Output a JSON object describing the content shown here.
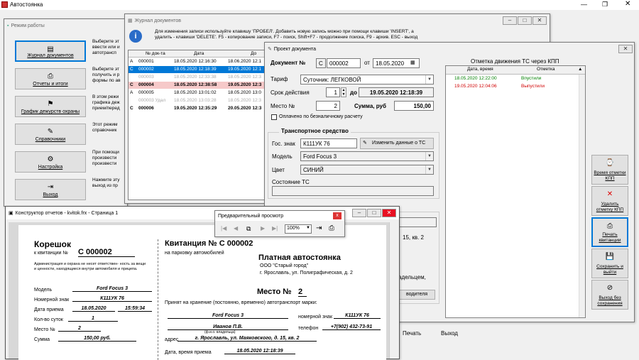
{
  "app": {
    "title": "Автостоянка"
  },
  "mode_window": {
    "title": "Режим работы",
    "buttons": [
      {
        "label": "Журнал документов",
        "icon": "journal-icon",
        "desc": "Выберите эт ввести или и автотрансп"
      },
      {
        "label": "Отчеты и итоги",
        "icon": "printer-icon",
        "desc": "Выберите эт получить и р формы по ав"
      },
      {
        "label": "График дежурств охраны",
        "icon": "guard-icon",
        "desc": "В этом режи графика деж прием/перед"
      },
      {
        "label": "Справочники",
        "icon": "book-icon",
        "desc": "Этот режим справочник"
      },
      {
        "label": "Настройка",
        "icon": "settings-icon",
        "desc": "При помощи произвести произвести"
      },
      {
        "label": "Выход",
        "icon": "exit-icon",
        "desc": "Нажмите эту выход из пр"
      }
    ]
  },
  "journal": {
    "title": "Журнал документов",
    "hint": "Для изменения записи используйте клавишу 'ПРОБЕЛ'. Добавить новую запись можно при помощи клавиши 'INSERT', а удалить - клавиши 'DELETE'. F5 - копирование записи, F7 - поиск, Shift+F7 - продолжение поиска, F9 - архив. ESC - выход",
    "columns": [
      "№ док-та",
      "Дата",
      "До"
    ],
    "rows": [
      {
        "mark": "A",
        "num": "000001",
        "date": "18.05.2020 12:16:30",
        "to": "18.06.2020 12:1"
      },
      {
        "mark": "C",
        "num": "000002",
        "date": "18.05.2020 12:18:39",
        "to": "19.05.2020 12:1"
      },
      {
        "mark": "",
        "num": "000003",
        "date": "18.05.2020 12:33:38",
        "to": "18.05.2020 12:3"
      },
      {
        "mark": "C",
        "num": "000004",
        "date": "18.05.2020 12:38:58",
        "to": "19.05.2020 12:3"
      },
      {
        "mark": "A",
        "num": "000005",
        "date": "18.05.2020 13:01:02",
        "to": "18.05.2020 13:0"
      },
      {
        "mark": "",
        "num": "000003 Удал",
        "date": "18.05.2020 13:03:28",
        "to": "18.05.2020 12:3"
      },
      {
        "mark": "C",
        "num": "000006",
        "date": "19.05.2020 12:35:29",
        "to": "20.05.2020 12:3"
      }
    ]
  },
  "project": {
    "title": "Проект документа",
    "doc_label": "Документ №",
    "doc_prefix": "C",
    "doc_num": "000002",
    "date_label": "от",
    "date": "18.05.2020",
    "tariff_label": "Тариф",
    "tariff": "Суточник: ЛЕГКОВОЙ",
    "term_label": "Срок действия",
    "term": "1",
    "until_label": "до",
    "until": "19.05.2020 12:18:39",
    "place_label": "Место №",
    "place": "2",
    "sum_label": "Сумма, руб",
    "sum": "150,00",
    "paid_label": "Оплачено по безналичному расчету",
    "vehicle_group": "Транспортное средство",
    "plate_label": "Гос. знак",
    "plate": "К111УК 76",
    "edit_vehicle": "Изменить данные о ТС",
    "model_label": "Модель",
    "model": "Ford Focus 3",
    "color_label": "Цвет",
    "color": "СИНИЙ",
    "state_label": "Состояние ТС",
    "state": "",
    "behind_addr": "15, кв. 2",
    "behind_owner": "адельцем,",
    "behind_driver": "водителя",
    "kpp_title": "Отметка движения ТС через КПП",
    "kpp_cols": [
      "Дата, время",
      "Отметка"
    ],
    "kpp_rows": [
      {
        "dt": "18.05.2020 12:22:00",
        "mark": "Впустили",
        "color": "#008000"
      },
      {
        "dt": "19.05.2020 12:04:06",
        "mark": "Выпустили",
        "color": "#d00000"
      }
    ],
    "side_buttons": [
      "Время отметки КПП",
      "Удалить отметку КПП",
      "Печать квитанции",
      "Сохранить и выйти",
      "Выход без сохранения"
    ],
    "bottom_print": "Печать",
    "bottom_exit": "Выход"
  },
  "preview": {
    "title": "Предварительный просмотр",
    "zoom": "100%"
  },
  "designer": {
    "title": "Конструктор отчетов - kvitok.frx - Страница 1"
  },
  "receipt": {
    "stub_title": "Корешок",
    "stub_sub": "к квитанции №",
    "stub_num": "C 000002",
    "stub_note": "Администрация и охрана не несет ответствен- ность за вещи и ценности, находящиеся внутри автомобиля и прицепа.",
    "model_l": "Модель",
    "model": "Ford Focus 3",
    "plate_l": "Номерной знак",
    "plate": "К111УК 76",
    "date_l": "Дата приема",
    "date": "18.05.2020",
    "time": "15:59:34",
    "days_l": "Кол-во суток",
    "days": "1",
    "place_l": "Место №",
    "place": "2",
    "sum_l": "Сумма",
    "sum": "150,00 руб.",
    "main_title": "Квитанция № C 000002",
    "main_sub": "на парковку автомобилей",
    "org_title": "Платная автостоянка",
    "org_name": "ООО \"Старый город\"",
    "org_addr": "г. Ярославль, ул. Полиграфическая, д. 2",
    "place_big_l": "Место №",
    "place_big": "2",
    "accepted": "Принят на хранение (постоянно, временно) автотранспорт марки:",
    "model2": "Ford Focus 3",
    "plate2_l": "номерной знак",
    "plate2": "К111УК 76",
    "owner": "Иванов П.В.",
    "owner_caption": "(ф.и.о. владельца)",
    "phone_l": "телефон",
    "phone": "+7(902) 432-73-91",
    "addr_l": "адрес",
    "addr": "г. Ярославль, ул. Маяковского, д. 15, кв. 2",
    "dt_l": "Дата, время приема",
    "dt": "18.05.2020 12:18:39"
  }
}
